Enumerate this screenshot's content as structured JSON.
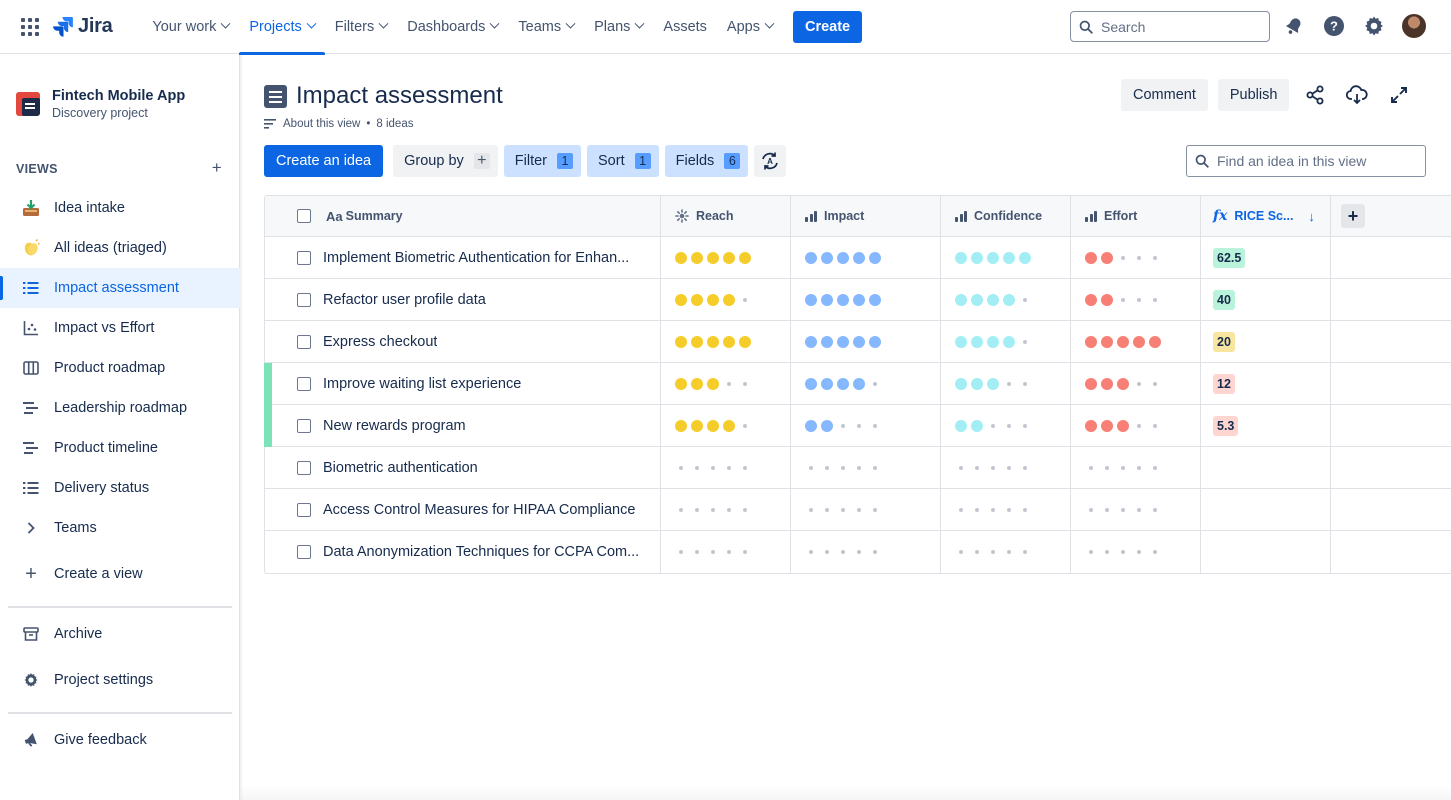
{
  "topnav": {
    "logo": "Jira",
    "items": [
      {
        "label": "Your work",
        "dropdown": true,
        "active": false
      },
      {
        "label": "Projects",
        "dropdown": true,
        "active": true
      },
      {
        "label": "Filters",
        "dropdown": true,
        "active": false
      },
      {
        "label": "Dashboards",
        "dropdown": true,
        "active": false
      },
      {
        "label": "Teams",
        "dropdown": true,
        "active": false
      },
      {
        "label": "Plans",
        "dropdown": true,
        "active": false
      },
      {
        "label": "Assets",
        "dropdown": false,
        "active": false
      },
      {
        "label": "Apps",
        "dropdown": true,
        "active": false
      }
    ],
    "create_label": "Create",
    "search_placeholder": "Search"
  },
  "sidebar": {
    "project_name": "Fintech Mobile App",
    "project_type": "Discovery project",
    "views_heading": "VIEWS",
    "views": [
      {
        "label": "Idea intake",
        "icon": "inbox-tray-icon"
      },
      {
        "label": "All ideas (triaged)",
        "icon": "clapping-hands-icon"
      },
      {
        "label": "Impact assessment",
        "icon": "list-icon",
        "active": true
      },
      {
        "label": "Impact vs Effort",
        "icon": "scatter-matrix-icon"
      },
      {
        "label": "Product roadmap",
        "icon": "board-columns-icon"
      },
      {
        "label": "Leadership roadmap",
        "icon": "timeline-icon"
      },
      {
        "label": "Product timeline",
        "icon": "timeline-icon"
      },
      {
        "label": "Delivery status",
        "icon": "list-icon"
      },
      {
        "label": "Teams",
        "icon": "chevron-right-icon"
      }
    ],
    "create_view_label": "Create a view",
    "archive_label": "Archive",
    "settings_label": "Project settings",
    "feedback_label": "Give feedback"
  },
  "main": {
    "title": "Impact assessment",
    "about_label": "About this view",
    "ideas_count": "8 ideas",
    "comment_label": "Comment",
    "publish_label": "Publish",
    "toolbar": {
      "create_idea": "Create an idea",
      "group_by": "Group by",
      "filter": "Filter",
      "filter_count": "1",
      "sort": "Sort",
      "sort_count": "1",
      "fields": "Fields",
      "fields_count": "6"
    },
    "find_placeholder": "Find an idea in this view"
  },
  "table": {
    "columns": {
      "summary": "Summary",
      "reach": "Reach",
      "impact": "Impact",
      "confidence": "Confidence",
      "effort": "Effort",
      "rice": "RICE Sc..."
    },
    "colors": {
      "reach": "#f5cd2b",
      "impact": "#85b8ff",
      "confidence": "#a3eef4",
      "effort": "#f87f75"
    },
    "rows": [
      {
        "summary": "Implement Biometric Authentication for Enhan...",
        "reach": 5,
        "impact": 5,
        "confidence": 5,
        "effort": 2,
        "rice": "62.5",
        "rice_color": "#baf3db",
        "marked": false
      },
      {
        "summary": "Refactor user profile data",
        "reach": 4,
        "impact": 5,
        "confidence": 4,
        "effort": 2,
        "rice": "40",
        "rice_color": "#baf3db",
        "marked": false
      },
      {
        "summary": "Express checkout",
        "reach": 5,
        "impact": 5,
        "confidence": 4,
        "effort": 5,
        "rice": "20",
        "rice_color": "#f8e6a0",
        "marked": false
      },
      {
        "summary": "Improve waiting list experience",
        "reach": 3,
        "impact": 4,
        "confidence": 3,
        "effort": 3,
        "rice": "12",
        "rice_color": "#ffd5d2",
        "marked": true
      },
      {
        "summary": "New rewards program",
        "reach": 4,
        "impact": 2,
        "confidence": 2,
        "effort": 3,
        "rice": "5.3",
        "rice_color": "#ffd5d2",
        "marked": true
      },
      {
        "summary": "Biometric authentication",
        "reach": 0,
        "impact": 0,
        "confidence": 0,
        "effort": 0,
        "rice": "",
        "rice_color": "",
        "marked": false
      },
      {
        "summary": "Access Control Measures for HIPAA Compliance",
        "reach": 0,
        "impact": 0,
        "confidence": 0,
        "effort": 0,
        "rice": "",
        "rice_color": "",
        "marked": false
      },
      {
        "summary": "Data Anonymization Techniques for CCPA Com...",
        "reach": 0,
        "impact": 0,
        "confidence": 0,
        "effort": 0,
        "rice": "",
        "rice_color": "",
        "marked": false
      }
    ]
  }
}
